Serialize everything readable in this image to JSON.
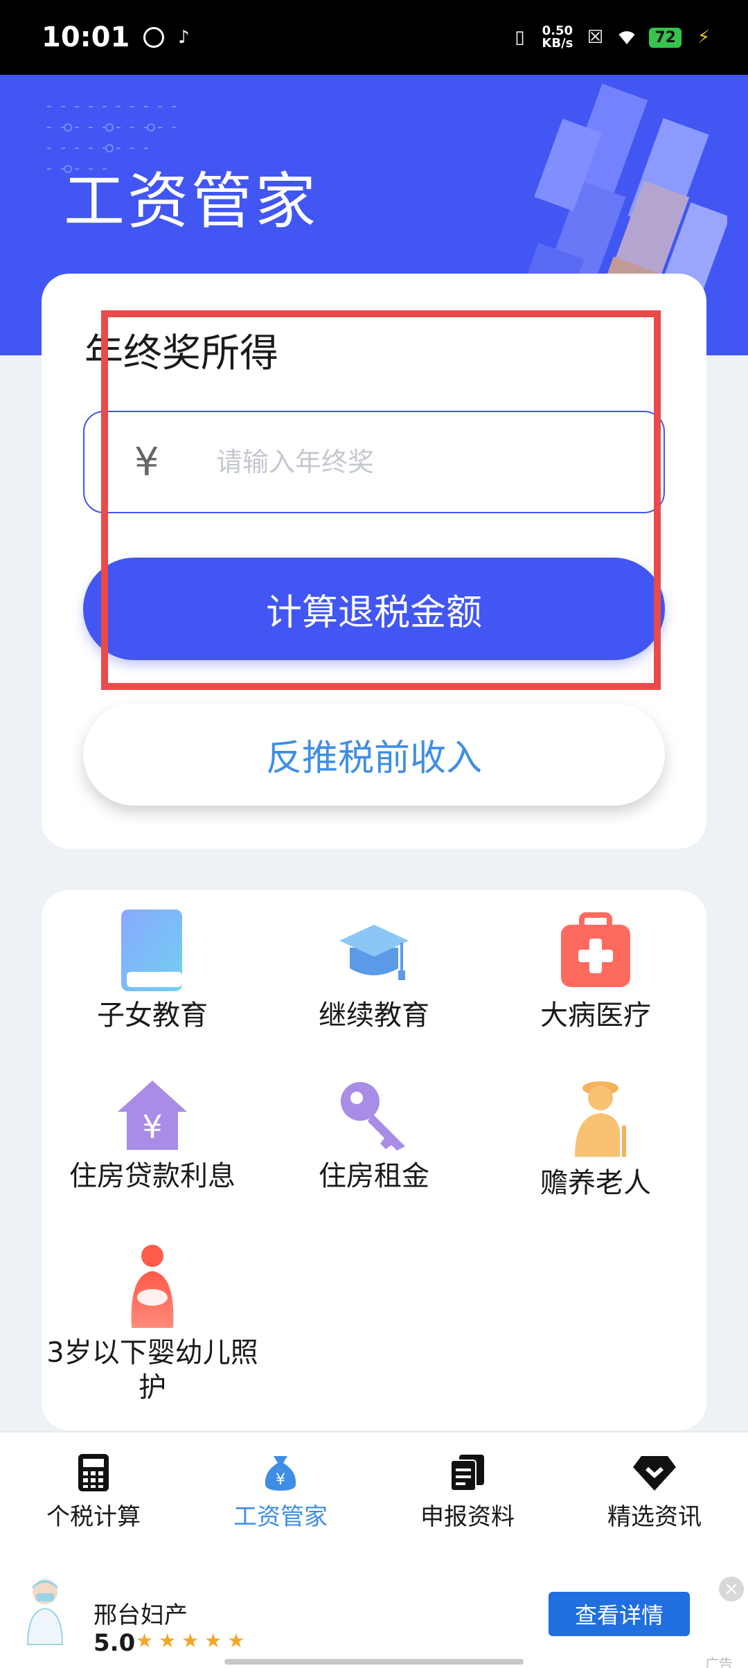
{
  "status_bar": {
    "time": "10:01",
    "net_speed_value": "0.50",
    "net_speed_unit": "KB/s",
    "battery": "72"
  },
  "header": {
    "title": "工资管家"
  },
  "calculator": {
    "title": "年终奖所得",
    "currency_symbol": "¥",
    "input_placeholder": "请输入年终奖",
    "input_value": "",
    "primary_button": "计算退税金额",
    "secondary_button": "反推税前收入"
  },
  "deductions": {
    "items": [
      {
        "label": "子女教育",
        "icon": "book-icon"
      },
      {
        "label": "继续教育",
        "icon": "graduation-cap-icon"
      },
      {
        "label": "大病医疗",
        "icon": "medical-kit-icon"
      },
      {
        "label": "住房贷款利息",
        "icon": "house-yen-icon"
      },
      {
        "label": "住房租金",
        "icon": "key-icon"
      },
      {
        "label": "赡养老人",
        "icon": "elderly-icon"
      },
      {
        "label": "3岁以下婴幼儿照护",
        "icon": "mother-baby-icon"
      }
    ]
  },
  "bottom_nav": {
    "items": [
      {
        "label": "个税计算",
        "icon": "calculator-icon"
      },
      {
        "label": "工资管家",
        "icon": "money-bag-icon",
        "active": true
      },
      {
        "label": "申报资料",
        "icon": "documents-icon"
      },
      {
        "label": "精选资讯",
        "icon": "news-icon"
      }
    ]
  },
  "ad": {
    "name": "邢台妇产",
    "rating": "5.0",
    "stars": "★★★★★",
    "button": "查看详情",
    "close": "×",
    "tag": "广告"
  },
  "colors": {
    "primary": "#4156f2",
    "link": "#3f8ee6",
    "highlight": "#ea4a4a"
  }
}
